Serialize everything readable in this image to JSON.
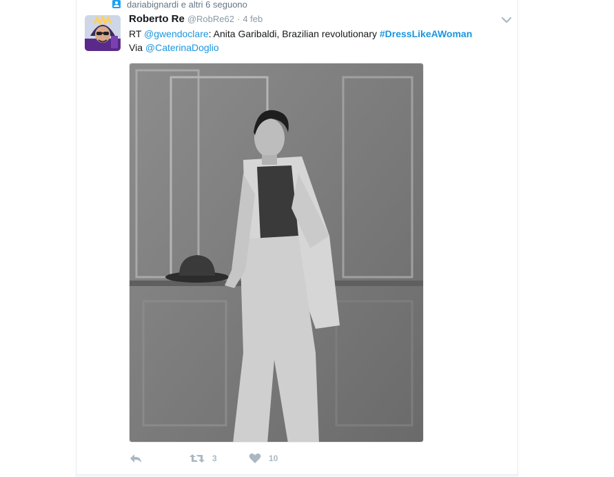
{
  "context": {
    "icon": "follow-icon",
    "text": "dariabignardi e altri 6 seguono"
  },
  "tweet": {
    "fullname": "Roberto Re",
    "username": "@RobRe62",
    "separator": "·",
    "time": "4 feb",
    "text": {
      "prefix": "RT ",
      "mention1": "@gwendoclare",
      "body": ": Anita Garibaldi, Brazilian revolutionary ",
      "hashtag": "#DressLikeAWoman",
      "via": "Via ",
      "mention2": "@CaterinaDoglio"
    },
    "media_alt": "Anita Garibaldi",
    "actions": {
      "reply_count": "",
      "retweet_count": "3",
      "like_count": "10"
    }
  },
  "colors": {
    "link": "#1b95e0",
    "muted": "#8899a6",
    "action": "#aab8c2",
    "border": "#e6ecf0",
    "icon_blue": "#1da1f2"
  }
}
